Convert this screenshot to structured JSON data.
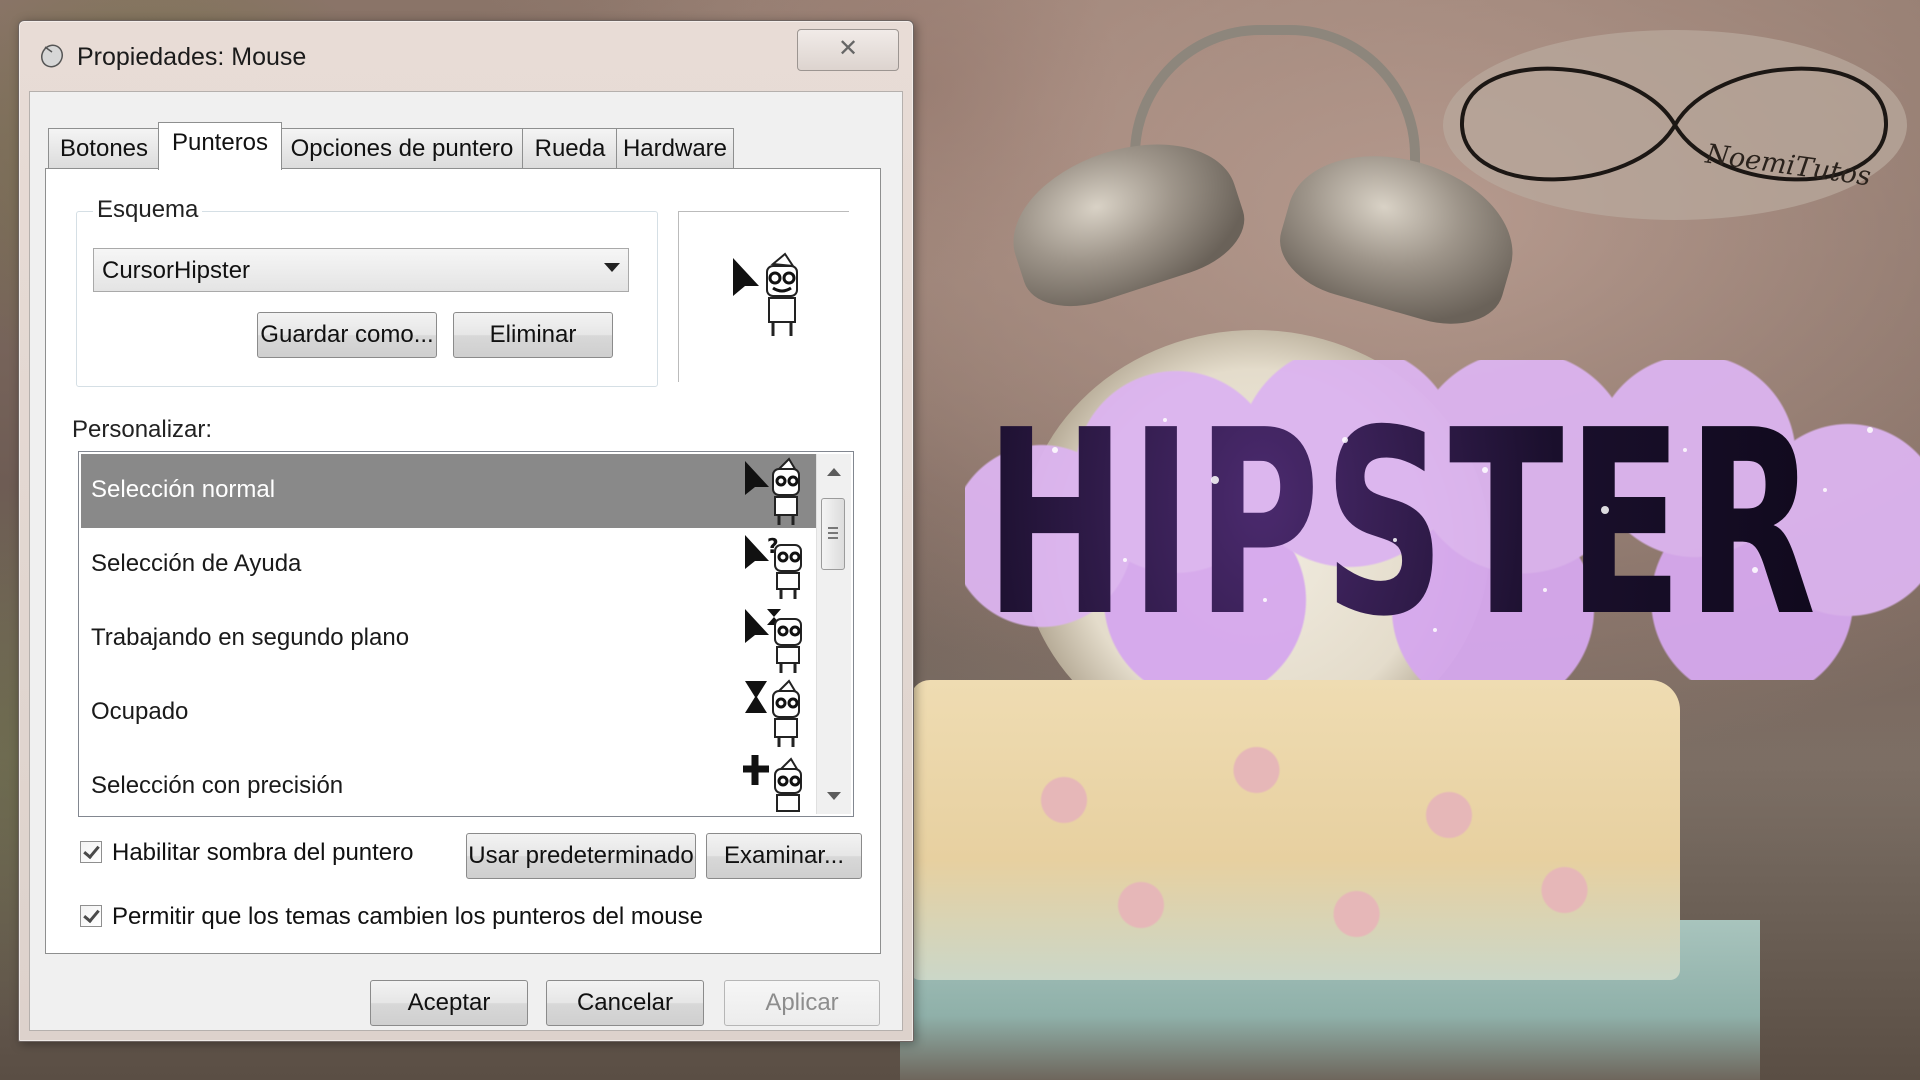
{
  "window": {
    "title": "Propiedades: Mouse",
    "close_glyph": "✕"
  },
  "tabs": [
    {
      "label": "Botones",
      "active": false
    },
    {
      "label": "Punteros",
      "active": true
    },
    {
      "label": "Opciones de puntero",
      "active": false
    },
    {
      "label": "Rueda",
      "active": false
    },
    {
      "label": "Hardware",
      "active": false
    }
  ],
  "scheme": {
    "group_label": "Esquema",
    "selected": "CursorHipster",
    "save_as_label": "Guardar como...",
    "delete_label": "Eliminar"
  },
  "customize": {
    "label": "Personalizar:",
    "items": [
      {
        "name": "Selección normal",
        "selected": true,
        "icon": "arrow-cursor-icon"
      },
      {
        "name": "Selección de Ayuda",
        "selected": false,
        "icon": "help-cursor-icon"
      },
      {
        "name": "Trabajando en segundo plano",
        "selected": false,
        "icon": "busy-background-cursor-icon"
      },
      {
        "name": "Ocupado",
        "selected": false,
        "icon": "hourglass-cursor-icon"
      },
      {
        "name": "Selección con precisión",
        "selected": false,
        "icon": "crosshair-cursor-icon"
      }
    ]
  },
  "options": {
    "shadow_label": "Habilitar sombra del puntero",
    "shadow_checked": true,
    "themes_label": "Permitir que los temas cambien los punteros del mouse",
    "themes_checked": true,
    "use_default_label": "Usar predeterminado",
    "browse_label": "Examinar..."
  },
  "footer": {
    "ok_label": "Aceptar",
    "cancel_label": "Cancelar",
    "apply_label": "Aplicar"
  },
  "overlay": {
    "headline": "HIPSTER",
    "logo_text": "NoemiTutos"
  },
  "colors": {
    "selection": "#898989",
    "cloud": "#dcb4f0",
    "text_fill": "#1c1030"
  }
}
